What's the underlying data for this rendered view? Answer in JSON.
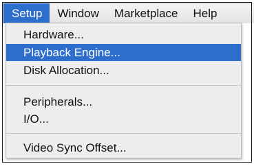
{
  "menubar": {
    "items": [
      {
        "label": "Setup",
        "active": true
      },
      {
        "label": "Window",
        "active": false
      },
      {
        "label": "Marketplace",
        "active": false
      },
      {
        "label": "Help",
        "active": false
      }
    ]
  },
  "dropdown": {
    "groups": [
      {
        "items": [
          {
            "label": "Hardware...",
            "highlighted": false
          },
          {
            "label": "Playback Engine...",
            "highlighted": true
          },
          {
            "label": "Disk Allocation...",
            "highlighted": false
          }
        ]
      },
      {
        "items": [
          {
            "label": "Peripherals...",
            "highlighted": false
          },
          {
            "label": "I/O...",
            "highlighted": false
          }
        ]
      },
      {
        "items": [
          {
            "label": "Video Sync Offset...",
            "highlighted": false
          }
        ]
      }
    ]
  },
  "colors": {
    "highlight": "#2e6fce",
    "menu_background": "#ededed"
  }
}
